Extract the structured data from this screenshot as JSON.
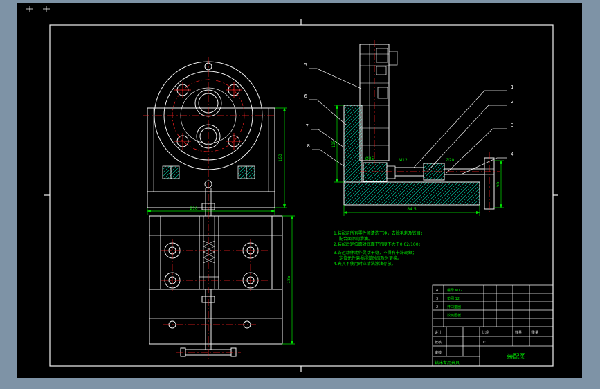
{
  "window": {
    "bg": "#7e93a6",
    "canvas_bg": "#000000"
  },
  "colors": {
    "line": "#f2f2f2",
    "centerline": "#ff2020",
    "dimension": "#00e400",
    "hatch": "#00b894"
  },
  "balloons": {
    "right": [
      "1",
      "2",
      "3",
      "4"
    ],
    "left": [
      "5",
      "6",
      "7",
      "8"
    ]
  },
  "dims": {
    "top_height": "160",
    "top_width": "210",
    "front_height": "185",
    "section_bottom": "84.5",
    "section_left": "115",
    "pin_right": "65",
    "thread": "M12",
    "dia": "Ø20",
    "dia2": "Ø25"
  },
  "notes": {
    "l1": "1.装配前所有零件须清洗干净，去除毛刺及铁屑；",
    "l2": "配合面涂润滑油。",
    "l3": "2.装配后定位面对底面平行度不大于0.02/100；",
    "l4": "3.各运动件动作灵活平稳，不得有卡滞现象；",
    "l5": "定位元件磨损超差时应及时更换。",
    "l6": "4.夹具不使用时应清洗涂油存放。"
  },
  "bom": {
    "rows": [
      {
        "no": "4",
        "name": "螺母 M12"
      },
      {
        "no": "3",
        "name": "垫圈 12"
      },
      {
        "no": "2",
        "name": "开口垫圈"
      },
      {
        "no": "1",
        "name": "铰链压板"
      }
    ]
  },
  "title_block": {
    "design": "设计",
    "check": "校核",
    "audit": "审核",
    "scale_label": "比例",
    "scale": "1:1",
    "qty_label": "数量",
    "qty": "1",
    "weight_label": "重量",
    "name": "装配图",
    "sub_name": "钻床专用夹具"
  }
}
